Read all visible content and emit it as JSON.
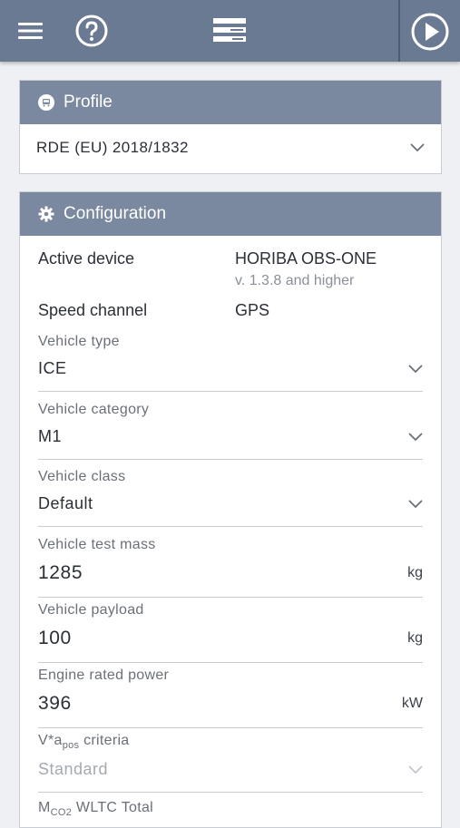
{
  "header": {
    "icons": [
      "menu-icon",
      "help-icon",
      "data-layers-icon",
      "play-icon"
    ]
  },
  "profile": {
    "title": "Profile",
    "selected": "RDE (EU) 2018/1832"
  },
  "configuration": {
    "title": "Configuration",
    "active_device_label": "Active device",
    "active_device_value": "HORIBA OBS-ONE",
    "active_device_version": "v. 1.3.8 and higher",
    "speed_channel_label": "Speed channel",
    "speed_channel_value": "GPS",
    "vehicle_type_label": "Vehicle type",
    "vehicle_type_value": "ICE",
    "vehicle_category_label": "Vehicle category",
    "vehicle_category_value": "M1",
    "vehicle_class_label": "Vehicle class",
    "vehicle_class_value": "Default",
    "test_mass_label": "Vehicle test mass",
    "test_mass_value": "1285",
    "test_mass_unit": "kg",
    "payload_label": "Vehicle payload",
    "payload_value": "100",
    "payload_unit": "kg",
    "engine_power_label": "Engine rated power",
    "engine_power_value": "396",
    "engine_power_unit": "kW",
    "vapos_label_main": "V*a",
    "vapos_label_sub": "pos",
    "vapos_label_rest": " criteria",
    "vapos_value": "Standard",
    "mco2_label_main": "M",
    "mco2_label_sub": "CO2",
    "mco2_label_rest": " WLTC Total"
  }
}
